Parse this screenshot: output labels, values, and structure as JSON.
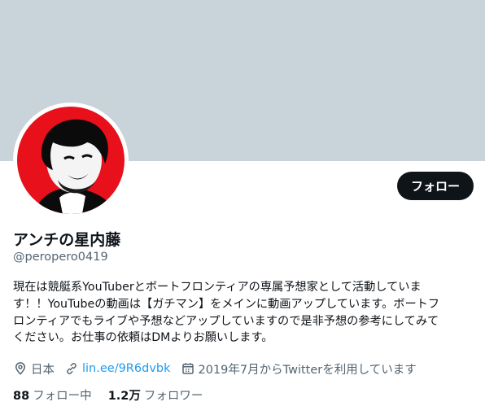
{
  "profile": {
    "display_name": "アンチの星内藤",
    "handle": "@peropero0419",
    "bio_lines": [
      "現在は競艇系YouTuberとボートフロンティアの専属予想家として活動していま",
      "す！！YouTubeの動画は【ガチマン】をメインに動画アップしています。ボートフ",
      "ロンティアでもライブや予想などアップしていますので是非予想の参考にしてみて",
      "ください。お仕事の依頼はDMよりお願いします。"
    ],
    "location": "日本",
    "link": "lin.ee/9R6dvbk",
    "joined": "2019年7月からTwitterを利用しています",
    "following_count": "88",
    "following_label": "フォロー中",
    "followers_count": "1.2万",
    "followers_label": "フォロワー"
  },
  "actions": {
    "follow_label": "フォロー"
  },
  "icons": {
    "location": "location-pin-icon",
    "link": "link-icon",
    "joined": "calendar-icon"
  },
  "colors": {
    "banner": "#c8d4da",
    "avatar_bg": "#e8101a",
    "link": "#1d9bf0",
    "button": "#0f1419",
    "secondary_text": "#536471"
  }
}
